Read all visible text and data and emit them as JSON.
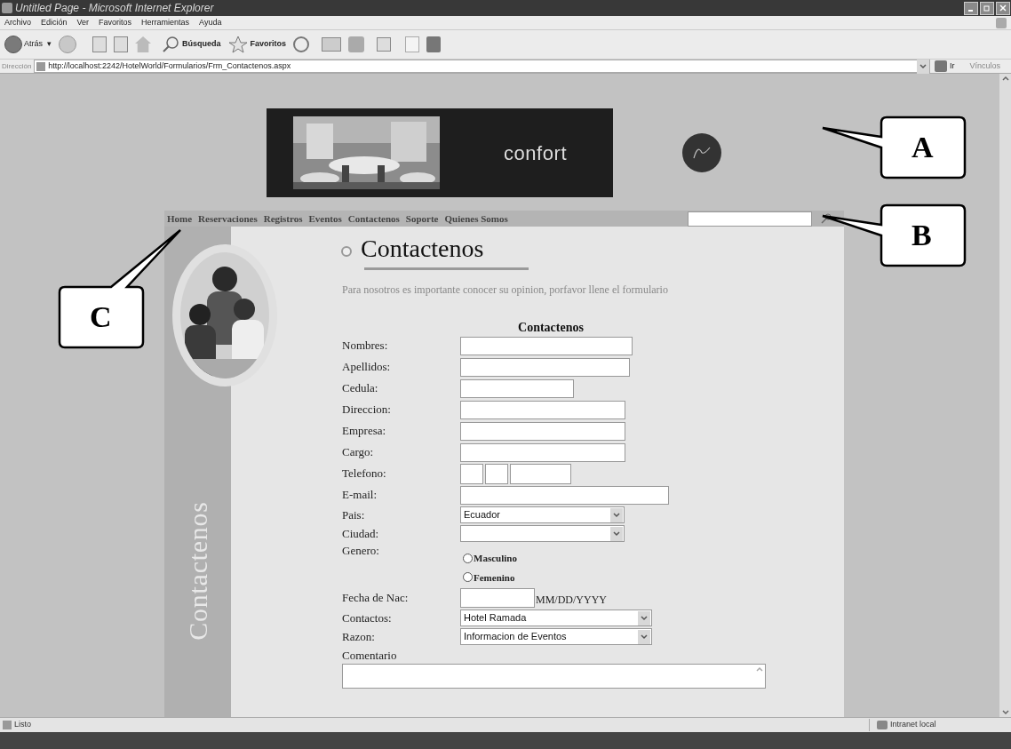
{
  "window": {
    "title": "Untitled Page - Microsoft Internet Explorer"
  },
  "menu": [
    "Archivo",
    "Edición",
    "Ver",
    "Favoritos",
    "Herramientas",
    "Ayuda"
  ],
  "toolbar": {
    "back": "Atrás",
    "back_dropdown": "▾",
    "search": "Búsqueda",
    "favorites": "Favoritos"
  },
  "address_bar": {
    "label": "Dirección",
    "url": "http://localhost:2242/HotelWorld/Formularios/Frm_Contactenos.aspx",
    "go": "Ir",
    "links": "Vínculos"
  },
  "page": {
    "banner": {
      "text": "confort"
    },
    "nav": [
      "Home",
      "Reservaciones",
      "Registros",
      "Eventos",
      "Contactenos",
      "Soporte",
      "Quienes Somos"
    ],
    "sidebar_text": "Contactenos",
    "heading": "Contactenos",
    "intro": "Para nosotros es importante conocer su opinion, porfavor llene el formulario",
    "form": {
      "title": "Contactenos",
      "fields": [
        {
          "kind": "text",
          "label": "Nombres:"
        },
        {
          "kind": "text",
          "label": "Apellidos:"
        },
        {
          "kind": "text",
          "label": "Cedula:"
        },
        {
          "kind": "text",
          "label": "Direccion:"
        },
        {
          "kind": "text",
          "label": "Empresa:"
        },
        {
          "kind": "text",
          "label": "Cargo:"
        },
        {
          "kind": "phone",
          "label": "Telefono:"
        },
        {
          "kind": "text",
          "label": "E-mail:"
        },
        {
          "kind": "select",
          "label": "Pais:",
          "value": "Ecuador"
        },
        {
          "kind": "select",
          "label": "Ciudad:"
        },
        {
          "kind": "radio",
          "label": "Genero:",
          "options": [
            {
              "label": "Masculino",
              "selected": false
            },
            {
              "label": "Femenino",
              "selected": false
            }
          ]
        },
        {
          "kind": "date",
          "label": "Fecha de Nac:",
          "hint": "MM/DD/YYYY"
        },
        {
          "kind": "select",
          "label": "Contactos:",
          "value": "Hotel Ramada"
        },
        {
          "kind": "select",
          "label": "Razon:",
          "value": "Informacion de Eventos"
        },
        {
          "kind": "textarea",
          "label": "Comentario"
        }
      ]
    }
  },
  "callouts": [
    "A",
    "B",
    "C"
  ],
  "status_bar": {
    "text": "Listo",
    "zone": "Intranet local"
  }
}
